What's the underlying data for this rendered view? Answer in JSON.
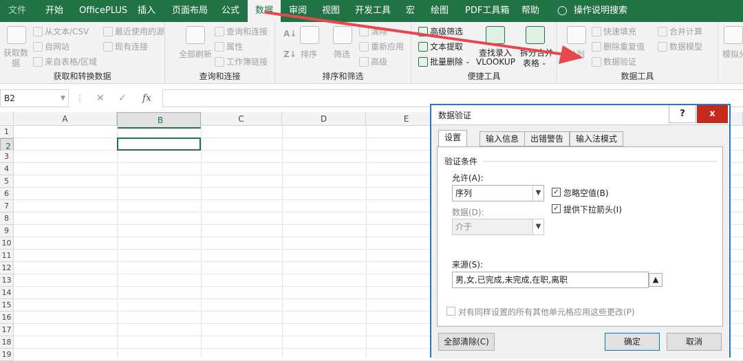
{
  "menu": {
    "items": [
      "文件",
      "开始",
      "OfficePLUS",
      "插入",
      "页面布局",
      "公式",
      "数据",
      "审阅",
      "视图",
      "开发工具",
      "宏",
      "绘图",
      "PDF工具箱",
      "帮助",
      "操作说明搜索"
    ],
    "active": "数据"
  },
  "ribbon": {
    "get_transform": {
      "label": "获取和转换数据",
      "get_data": "获取数\n据",
      "from_text": "从文本/CSV",
      "from_web": "自网站",
      "from_table": "来自表格/区域",
      "recent_sources": "最近使用的源",
      "existing_connections": "现有连接"
    },
    "queries": {
      "label": "查询和连接",
      "refresh_all": "全部刷新",
      "queries_connections": "查询和连接",
      "properties": "属性",
      "edit_links": "工作簿链接"
    },
    "sort_filter": {
      "label": "排序和筛选",
      "sort": "排序",
      "filter": "筛选",
      "clear": "清除",
      "reapply": "重新应用",
      "advanced": "高级"
    },
    "quick_tools": {
      "label": "便捷工具",
      "advanced_filter": "高级筛选",
      "text_extract": "文本提取",
      "batch_delete": "批量删除",
      "vlookup_line1": "查找录入",
      "vlookup_line2": "VLOOKUP",
      "merge_line1": "拆分合并",
      "merge_line2": "表格"
    },
    "data_tools": {
      "label": "数据工具",
      "split": "分列",
      "flash_fill": "快速填充",
      "remove_duplicates": "删除重复值",
      "data_validation": "数据验证",
      "consolidate": "合并计算",
      "data_model": "数据模型",
      "whatif": "模拟分"
    }
  },
  "formula_bar": {
    "name_box": "B2",
    "fx": "fx",
    "content": ""
  },
  "sheet": {
    "columns": [
      "A",
      "B",
      "C",
      "D",
      "E"
    ],
    "rows": [
      "1",
      "2",
      "3",
      "4",
      "5",
      "6",
      "7",
      "8",
      "9",
      "10",
      "11",
      "12",
      "13",
      "14",
      "15",
      "16",
      "17",
      "18",
      "19"
    ],
    "selected_cell": "B2"
  },
  "dialog": {
    "title": "数据验证",
    "help": "?",
    "close": "x",
    "tabs": [
      "设置",
      "输入信息",
      "出错警告",
      "输入法模式"
    ],
    "active_tab": "设置",
    "section_title": "验证条件",
    "allow_label": "允许(A):",
    "allow_value": "序列",
    "data_label": "数据(D):",
    "data_value": "介于",
    "ignore_blank": "忽略空值(B)",
    "ignore_blank_checked": true,
    "dropdown_label": "提供下拉箭头(I)",
    "dropdown_checked": true,
    "source_label": "来源(S):",
    "source_value": "男,女,已完成,未完成,在职,离职",
    "apply_all": "对有同样设置的所有其他单元格应用这些更改(P)",
    "clear_all": "全部清除(C)",
    "ok": "确定",
    "cancel": "取消"
  },
  "colors": {
    "excel_green": "#217346",
    "annotation_arrow": "#e8474c",
    "dialog_border": "#1f78d1"
  }
}
